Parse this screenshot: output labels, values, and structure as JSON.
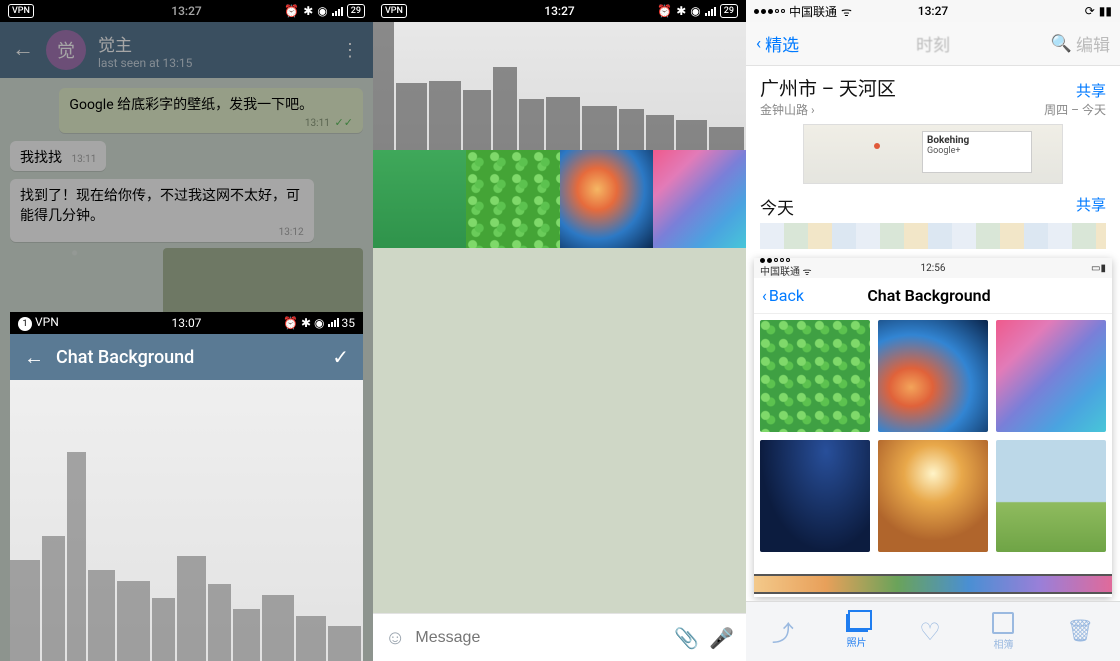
{
  "panel1": {
    "status": {
      "time": "13:27",
      "batt": "29",
      "vpn": "VPN"
    },
    "header": {
      "avatar_initial": "觉",
      "name": "觉主",
      "last_seen": "last seen at 13:15"
    },
    "messages": [
      {
        "dir": "out",
        "text": "Google 给底彩字的壁纸，发我一下吧。",
        "time": "13:11"
      },
      {
        "dir": "in",
        "text": "我找找",
        "time": "13:11"
      },
      {
        "dir": "in",
        "text": "找到了！现在给你传，不过我这网不太好，可能得几分钟。",
        "time": "13:12"
      }
    ],
    "overlay": {
      "status_time": "13:07",
      "status_batt": "35",
      "title": "Chat Background"
    }
  },
  "panel2": {
    "status": {
      "time": "13:27",
      "batt": "29"
    },
    "input_placeholder": "Message"
  },
  "panel3": {
    "status": {
      "carrier": "中国联通",
      "time": "13:27"
    },
    "nav": {
      "back": "精选",
      "center": "时刻",
      "edit": "编辑"
    },
    "section1": {
      "location_main": "广州市 – 天河区",
      "location_sub": "金钟山路",
      "share": "共享",
      "date_range": "周四 – 今天"
    },
    "map_card": {
      "title": "Bokehing",
      "sub": "Google+"
    },
    "section2": {
      "when": "今天",
      "share": "共享"
    },
    "overlay": {
      "status": {
        "carrier": "中国联通",
        "time": "12:56"
      },
      "back": "Back",
      "title": "Chat Background"
    },
    "toolbar": {
      "photos_label": "照片",
      "albums_label": "相簿"
    }
  }
}
